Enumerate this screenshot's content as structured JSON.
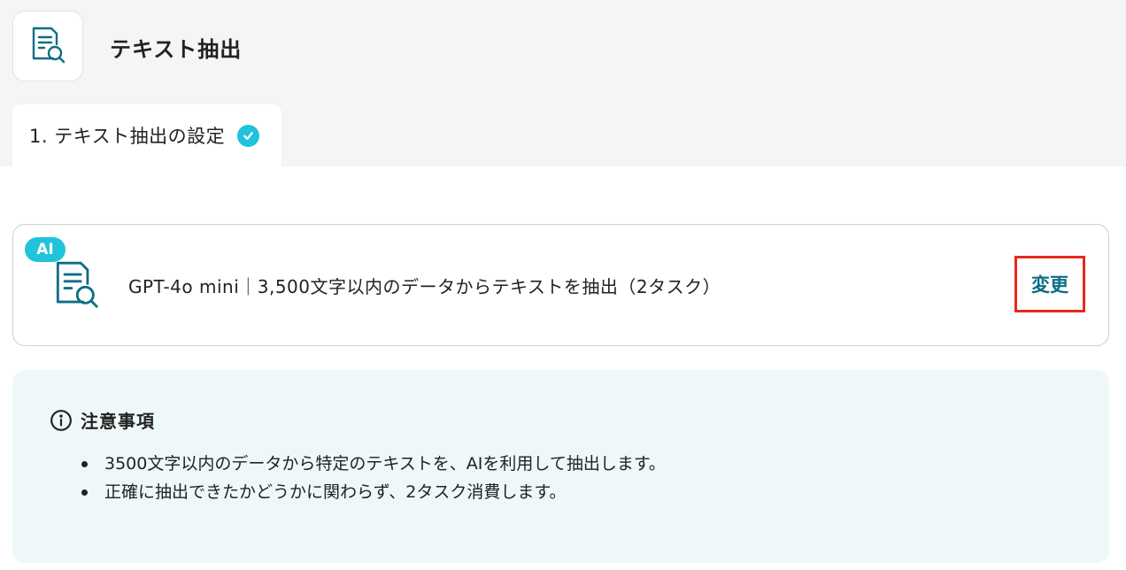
{
  "header": {
    "title": "テキスト抽出",
    "app_icon": "document-search-icon"
  },
  "steps": [
    {
      "label": "1. テキスト抽出の設定",
      "status": "complete",
      "icon": "check-circle-icon"
    }
  ],
  "ai_card": {
    "badge": "AI",
    "icon": "document-search-icon",
    "model_text": "GPT-4o mini｜3,500文字以内のデータからテキストを抽出（2タスク）",
    "change_label": "変更"
  },
  "notice": {
    "icon": "info-icon",
    "title": "注意事項",
    "items": [
      "3500文字以内のデータから特定のテキストを、AIを利用して抽出します。",
      "正確に抽出できたかどうかに関わらず、2タスク消費します。"
    ]
  },
  "colors": {
    "accent_teal": "#0c6e84",
    "badge_cyan": "#1fc3dc",
    "highlight_red": "#e8281e",
    "notice_bg": "#eff8f8",
    "top_bg": "#f5f5f5"
  }
}
